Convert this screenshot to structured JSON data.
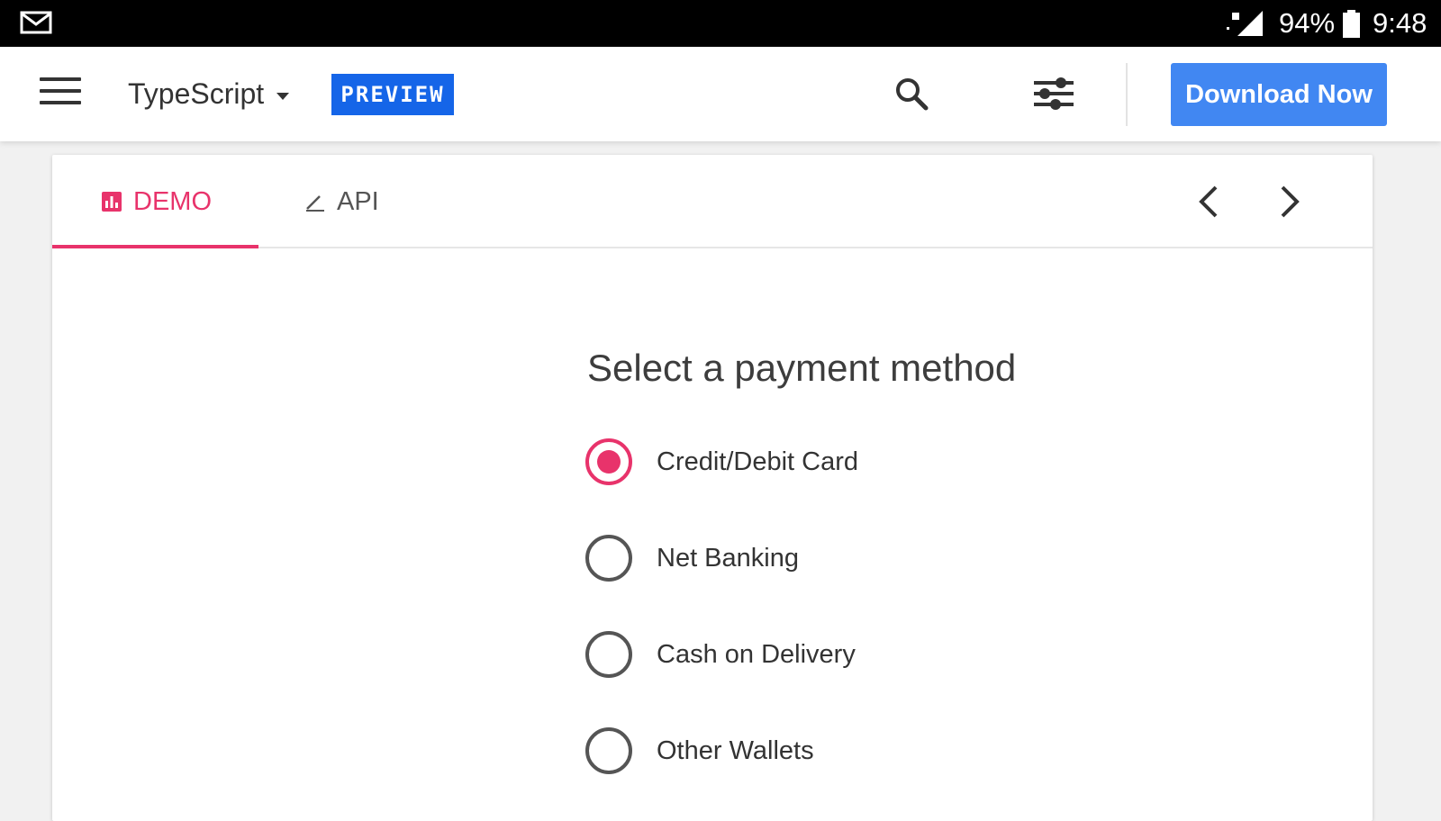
{
  "status_bar": {
    "battery_percent": "94%",
    "time": "9:48",
    "icons": [
      "mail-icon",
      "signal-icon",
      "battery-icon"
    ]
  },
  "app_bar": {
    "language": "TypeScript",
    "badge": "PREVIEW",
    "download_label": "Download Now",
    "icons": [
      "menu-icon",
      "search-icon",
      "settings-sliders-icon"
    ]
  },
  "tabs": {
    "items": [
      {
        "label": "DEMO",
        "icon": "chart-icon",
        "active": true
      },
      {
        "label": "API",
        "icon": "pencil-icon",
        "active": false
      }
    ]
  },
  "form": {
    "title": "Select a payment method",
    "options": [
      {
        "label": "Credit/Debit Card",
        "checked": true
      },
      {
        "label": "Net Banking",
        "checked": false
      },
      {
        "label": "Cash on Delivery",
        "checked": false
      },
      {
        "label": "Other Wallets",
        "checked": false
      }
    ]
  },
  "colors": {
    "accent": "#e8336b",
    "primary": "#4187f2",
    "badge": "#1565e8"
  }
}
